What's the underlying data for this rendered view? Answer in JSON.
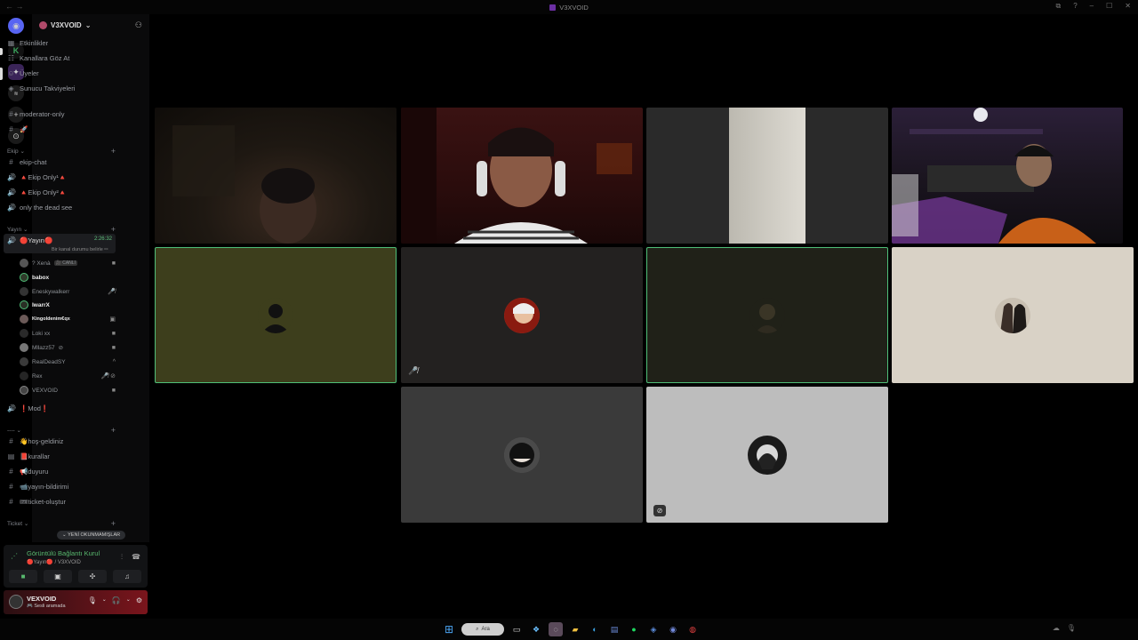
{
  "window": {
    "title": "V3XVOID",
    "nav_arrows": "← →",
    "controls": [
      "⧉",
      "?",
      "–",
      "☐",
      "✕"
    ]
  },
  "server": {
    "name": "V3XVOID"
  },
  "menu": [
    {
      "label": "Etkinlikler",
      "icon": "calendar-icon",
      "glyph": "▦"
    },
    {
      "label": "Kanallara Göz At",
      "icon": "browse-channels-icon",
      "glyph": "☷"
    },
    {
      "label": "Üyeler",
      "icon": "members-icon",
      "glyph": "☺"
    },
    {
      "label": "Sunucu Takviyeleri",
      "icon": "boost-icon",
      "glyph": "◈"
    }
  ],
  "channels_top": [
    {
      "label": "moderator-only",
      "icon": "#"
    },
    {
      "label": "🚀",
      "icon": "#"
    }
  ],
  "categories": {
    "ekip": "Ekip",
    "yayin": "Yayın",
    "dash": "----",
    "ticket": "Ticket"
  },
  "ekip_channels": [
    {
      "label": "ekip-chat",
      "icon": "#"
    },
    {
      "label": "🔺Ekip Only¹🔺",
      "icon": "🔊"
    },
    {
      "label": "🔺Ekip Only²🔺",
      "icon": "🔊"
    },
    {
      "label": "only the dead see",
      "icon": "🔊"
    }
  ],
  "active_voice": {
    "label": "🔴Yayın🔴",
    "time": "2:26:32",
    "topic": "Bir kanal durumu belirle ✏"
  },
  "voice_users": [
    {
      "name": "? Xenà",
      "extra": "🎥 CANLI",
      "icon": "■"
    },
    {
      "name": "babox",
      "icon": "",
      "bold": true
    },
    {
      "name": "Eneskywalkerr",
      "icon": "🎤̸"
    },
    {
      "name": "IwarrX",
      "icon": "",
      "bold": true
    },
    {
      "name": "Kingoldenim€qx",
      "icon": "▣"
    },
    {
      "name": "Loki xx",
      "icon": "■"
    },
    {
      "name": "Mllazz57",
      "extra": "⊘",
      "icon": "■"
    },
    {
      "name": "RealDeadSY",
      "icon": "^"
    },
    {
      "name": "Rex",
      "icon": "🎤̸ ⊘"
    },
    {
      "name": "VEXVOID",
      "icon": "■"
    }
  ],
  "mod_channel": {
    "label": "❗Mod❗",
    "icon": "🔊"
  },
  "dash_channels": [
    {
      "label": "👋hoş-geldiniz",
      "icon": "#"
    },
    {
      "label": "📕kurallar",
      "icon": "▤"
    },
    {
      "label": "📢duyuru",
      "icon": "#"
    },
    {
      "label": "📹yayın-bildirimi",
      "icon": "#"
    },
    {
      "label": "🎟ticket-oluştur",
      "icon": "#"
    }
  ],
  "new_unreads_label": "YENİ OKUNMAMIŞLAR",
  "voice_status": {
    "title": "Görüntülü Bağlantı Kurul",
    "sub": "🔴Yayın🔴 / V3XVOID"
  },
  "user": {
    "name": "VEXVOID",
    "status": "🎮 Sesli aramada"
  },
  "taskbar": {
    "search_label": "Ara"
  },
  "colors": {
    "speaking_border": "#4fbf78",
    "online_green": "#58b86e",
    "user_panel_red": "#7a151c"
  }
}
